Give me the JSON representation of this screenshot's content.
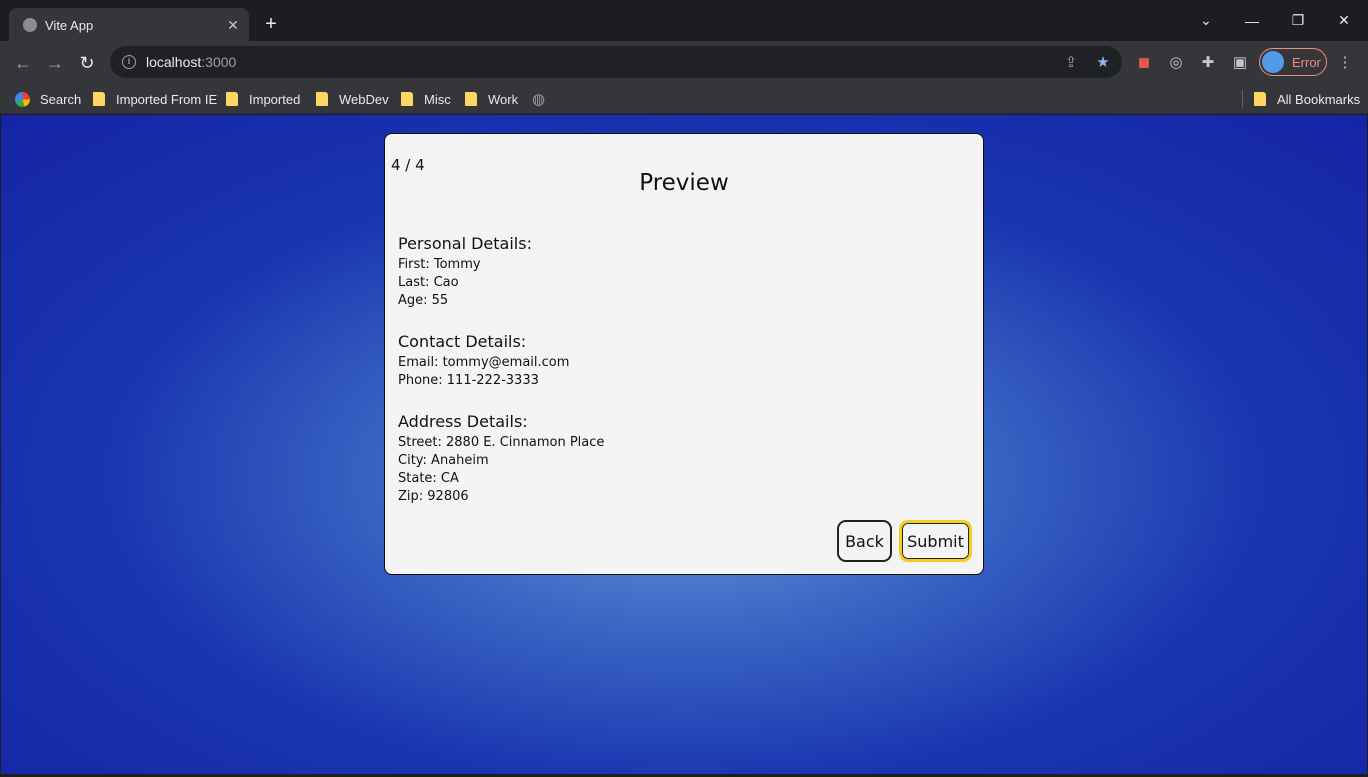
{
  "browser": {
    "tab_title": "Vite App",
    "url_host": "localhost",
    "url_port": ":3000",
    "error_label": "Error",
    "bookmarks": [
      "Search",
      "Imported From IE",
      "Imported",
      "WebDev",
      "Misc",
      "Work"
    ],
    "all_bookmarks": "All Bookmarks"
  },
  "card": {
    "step": "4 / 4",
    "title": "Preview",
    "personal": {
      "heading": "Personal Details:",
      "first": "First: Tommy",
      "last": "Last: Cao",
      "age": "Age: 55"
    },
    "contact": {
      "heading": "Contact Details:",
      "email": "Email: tommy@email.com",
      "phone": "Phone: 111-222-3333"
    },
    "address": {
      "heading": "Address Details:",
      "street": "Street: 2880 E. Cinnamon Place",
      "city": "City: Anaheim",
      "state": "State: CA",
      "zip": "Zip: 92806"
    },
    "back_label": "Back",
    "submit_label": "Submit"
  }
}
